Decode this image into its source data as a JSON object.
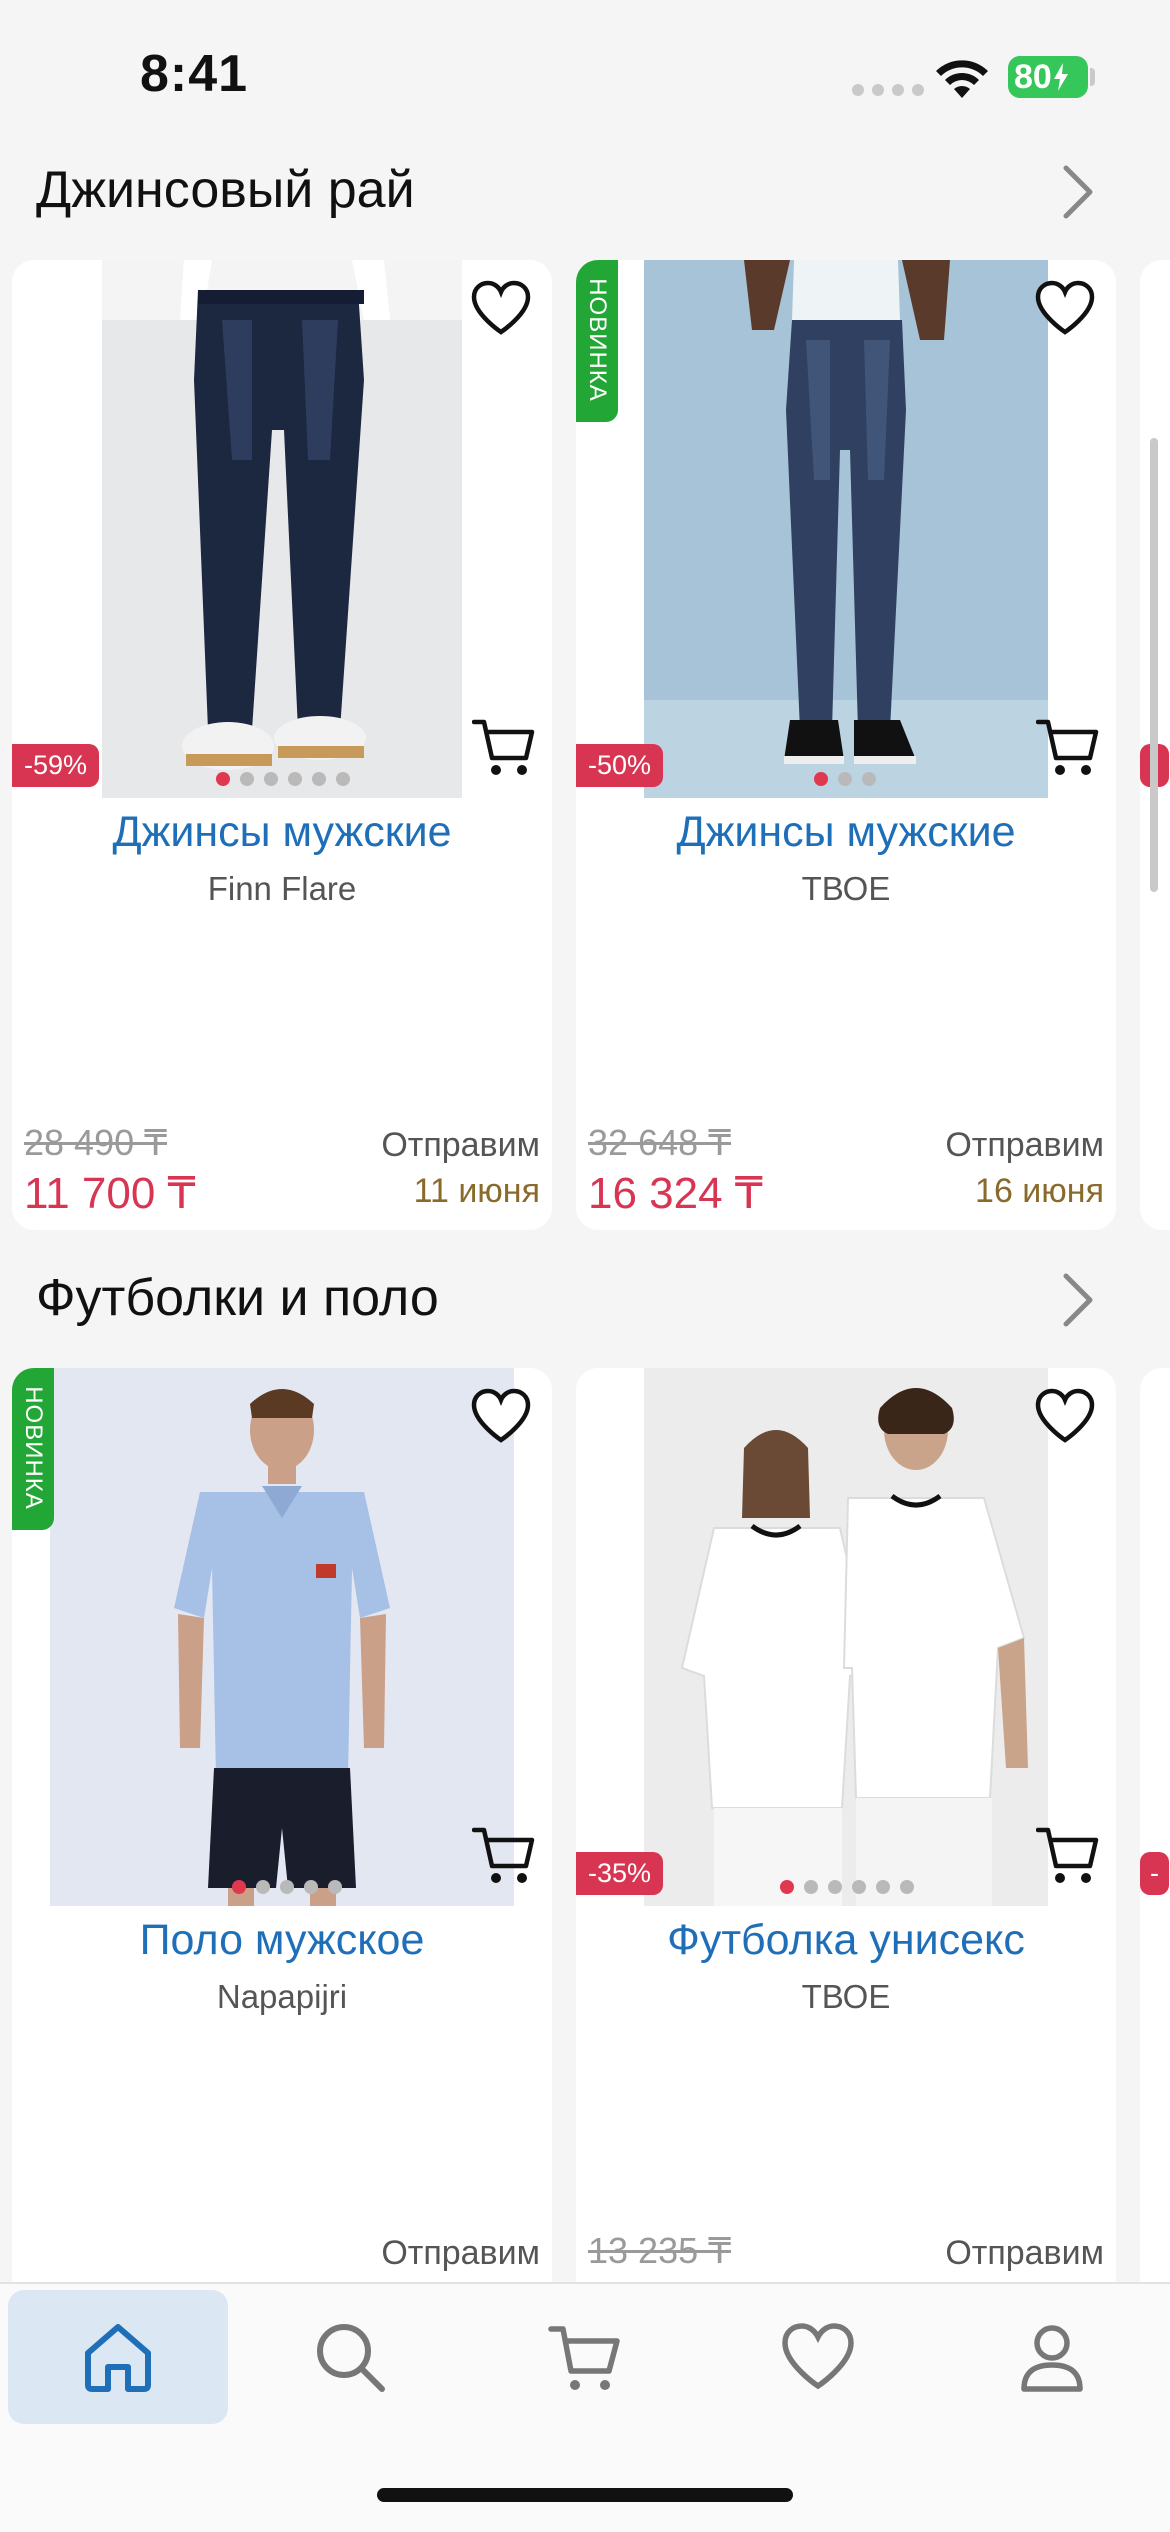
{
  "status_bar": {
    "time": "8:41",
    "battery": "80"
  },
  "sections": [
    {
      "title": "Джинсовый рай",
      "products": [
        {
          "name": "Джинсы мужские",
          "brand": "Finn Flare",
          "discount": "-59%",
          "is_new": false,
          "old_price": "28 490 ₸",
          "price": "11 700 ₸",
          "ship_label": "Отправим",
          "ship_date": "11 июня",
          "photo_count": 6,
          "photo_active": 0
        },
        {
          "name": "Джинсы мужские",
          "brand": "ТВОЕ",
          "discount": "-50%",
          "is_new": true,
          "new_label": "НОВИНКА",
          "old_price": "32 648 ₸",
          "price": "16 324 ₸",
          "ship_label": "Отправим",
          "ship_date": "16 июня",
          "photo_count": 3,
          "photo_active": 0
        }
      ]
    },
    {
      "title": "Футболки и поло",
      "products": [
        {
          "name": "Поло мужское",
          "brand": "Napapijri",
          "discount": "",
          "is_new": true,
          "new_label": "НОВИНКА",
          "old_price": "",
          "price": "",
          "ship_label": "Отправим",
          "ship_date": "",
          "photo_count": 5,
          "photo_active": 0
        },
        {
          "name": "Футболка унисекс",
          "brand": "ТВОЕ",
          "discount": "-35%",
          "is_new": false,
          "old_price": "13 235 ₸",
          "price": "",
          "ship_label": "Отправим",
          "ship_date": "",
          "photo_count": 6,
          "photo_active": 0
        }
      ]
    }
  ],
  "tabbar": {
    "items": [
      {
        "icon": "home-icon",
        "active": true
      },
      {
        "icon": "search-icon",
        "active": false
      },
      {
        "icon": "cart-icon",
        "active": false
      },
      {
        "icon": "heart-icon",
        "active": false
      },
      {
        "icon": "profile-icon",
        "active": false
      }
    ]
  },
  "colors": {
    "accent": "#1f6fb8",
    "price": "#d83553",
    "new_badge": "#22a636",
    "ship_date": "#8a6a2b",
    "active_tab_bg": "#dce7f4"
  }
}
